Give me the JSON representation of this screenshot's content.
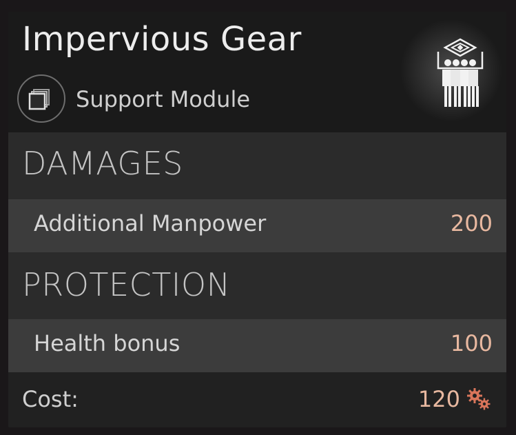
{
  "tooltip": {
    "title": "Impervious Gear",
    "type_icon": "stacked-squares-icon",
    "type_label": "Support Module",
    "unit_icon": "manpower-squad-icon"
  },
  "sections": [
    {
      "title": "DAMAGES",
      "stats": [
        {
          "name": "Additional Manpower",
          "value": "200"
        }
      ]
    },
    {
      "title": "PROTECTION",
      "stats": [
        {
          "name": "Health bonus",
          "value": "100"
        }
      ]
    }
  ],
  "cost": {
    "label": "Cost:",
    "value": "120",
    "icon": "gears-icon"
  },
  "colors": {
    "value": "#e8b8a0",
    "cost_icon": "#d9755a"
  }
}
